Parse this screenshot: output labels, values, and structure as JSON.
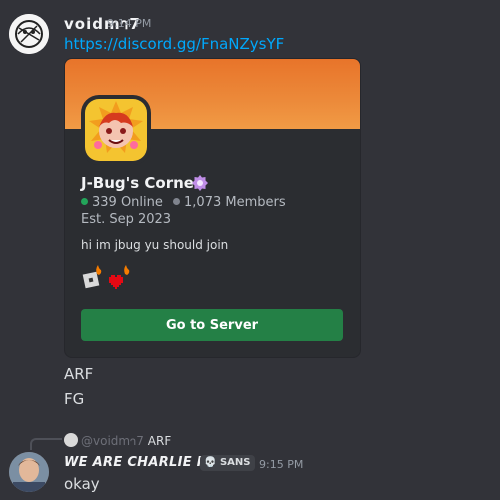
{
  "message1": {
    "username": "voidm𐐻7",
    "time": "9:14 PM",
    "link": "https://discord.gg/FnaNZysYF"
  },
  "invite": {
    "server_name": "J-Bug's Corner",
    "online": "339 Online",
    "members": "1,073 Members",
    "established": "Est. Sep 2023",
    "description": "hi im jbug yu should join",
    "button_label": "Go to Server",
    "colors": {
      "banner": "#ec8a3a",
      "button": "#248046",
      "online_dot": "#23a55a",
      "member_dot": "#80848e"
    }
  },
  "messages_followup": [
    "ARF",
    "FG"
  ],
  "reply": {
    "to_user": "@voidm𐐻7",
    "to_text": "ARF"
  },
  "message2": {
    "username": "WE ARE CHARLIE KIRK",
    "tag": "SANS",
    "tag_icon": "skull-icon",
    "time": "9:15 PM",
    "text": "okay"
  }
}
